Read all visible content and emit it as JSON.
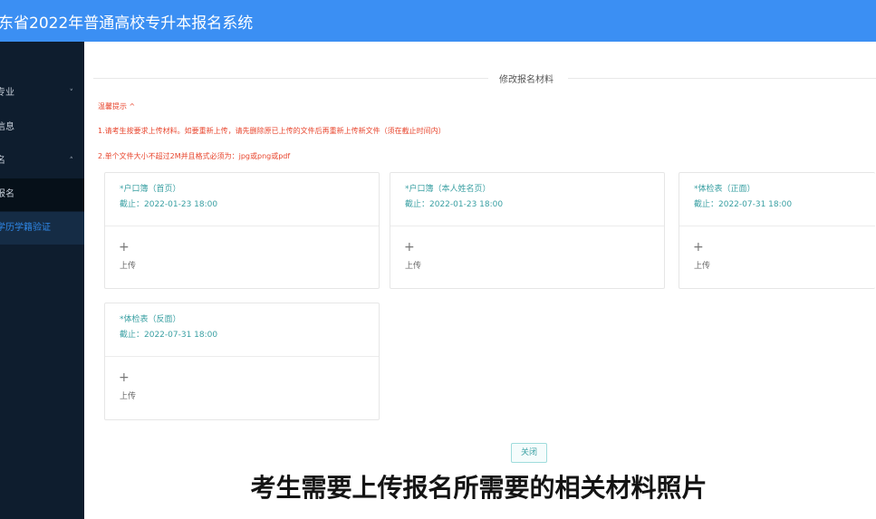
{
  "header": {
    "title": "东省2022年普通高校专升本报名系统"
  },
  "sidebar": {
    "items": [
      {
        "label": "专业",
        "chevron": "˅"
      },
      {
        "label": "信息",
        "chevron": ""
      },
      {
        "label": "名",
        "chevron": "˄"
      },
      {
        "label": "报名",
        "chevron": ""
      },
      {
        "label": "学历学籍验证",
        "chevron": ""
      }
    ]
  },
  "main": {
    "section_title": "修改报名材料",
    "tips": {
      "title": "温馨提示 ^",
      "line1": "1.请考生按要求上传材料。如要重新上传，请先删除原已上传的文件后再重新上传新文件（须在截止时间内）",
      "line2": "2.单个文件大小不超过2M并且格式必须为：jpg或png或pdf"
    },
    "cards": [
      {
        "name": "*户口簿（首页）",
        "deadline": "截止：2022-01-23 18:00",
        "plus": "+",
        "upload": "上传"
      },
      {
        "name": "*户口簿（本人姓名页）",
        "deadline": "截止：2022-01-23 18:00",
        "plus": "+",
        "upload": "上传"
      },
      {
        "name": "*体检表（正面）",
        "deadline": "截止：2022-07-31 18:00",
        "plus": "+",
        "upload": "上传"
      },
      {
        "name": "*体检表（反面）",
        "deadline": "截止：2022-07-31 18:00",
        "plus": "+",
        "upload": "上传"
      }
    ],
    "close_label": "关闭"
  },
  "caption": "考生需要上传报名所需要的相关材料照片",
  "colors": {
    "header": "#3b8ff3",
    "sidebar": "#0e1d2e",
    "accent": "#3aa0a3",
    "tip": "#e8462e"
  }
}
